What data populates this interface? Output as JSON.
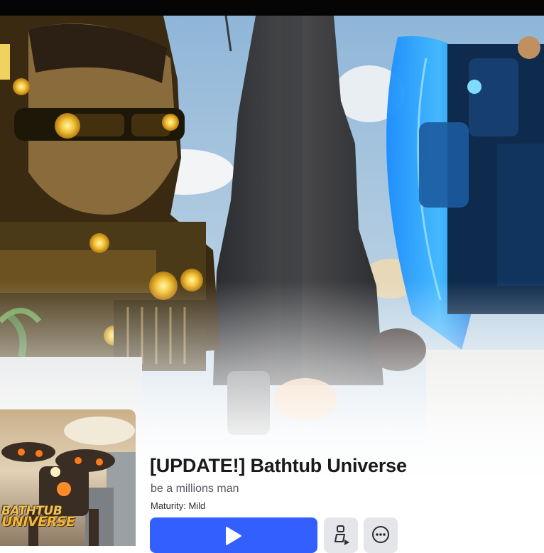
{
  "game": {
    "title": "[UPDATE!] Bathtub Universe",
    "description": "be a millions man",
    "maturity": "Maturity: Mild",
    "thumbnail_logo_line1": "BATHTUB",
    "thumbnail_logo_line2": "UNIVERSE"
  },
  "actions": {
    "play_icon": "play-icon",
    "avatar_icon": "avatar-play-icon",
    "more_icon": "more-options-icon"
  },
  "colors": {
    "play_button": "#335fff",
    "secondary_button": "#e4e6ea",
    "title_text": "#1a1a1d"
  }
}
